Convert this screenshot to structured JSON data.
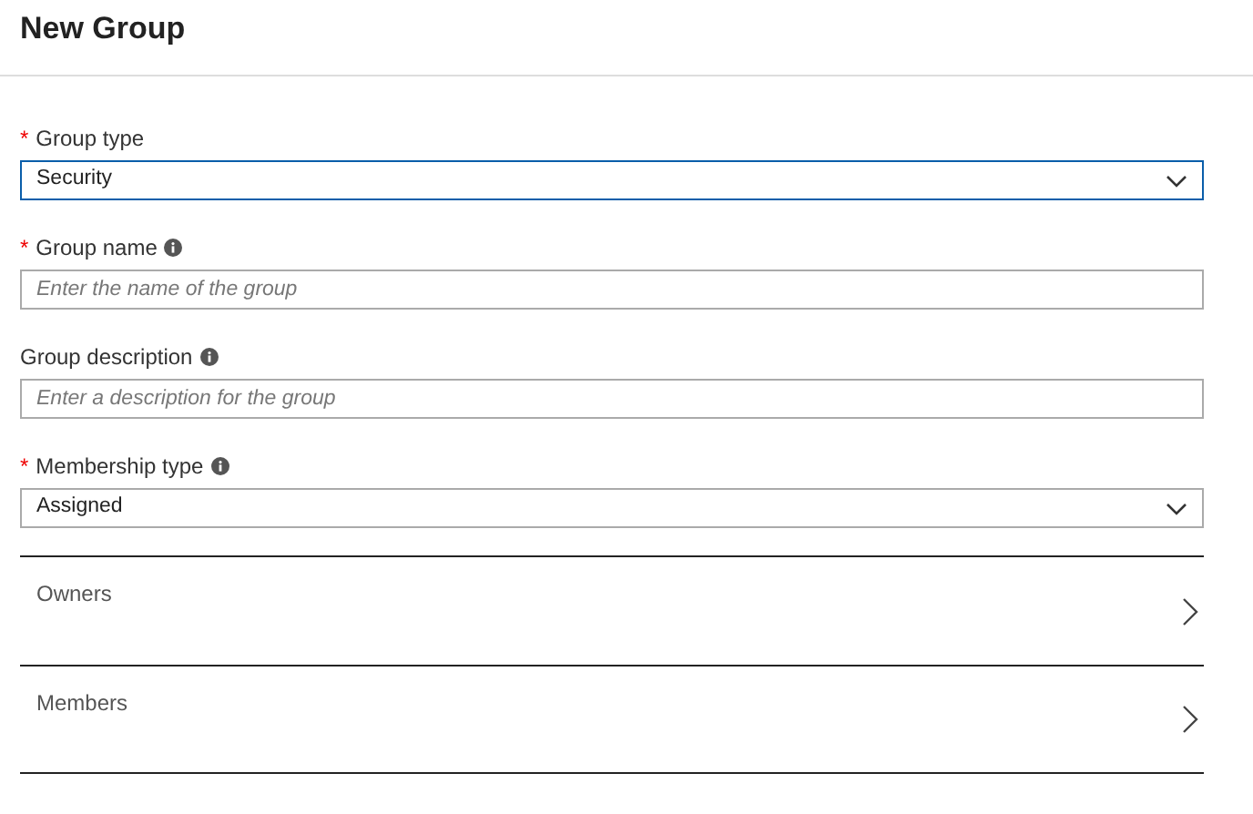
{
  "title": "New Group",
  "fields": [
    {
      "kind": "select",
      "marker": "*",
      "label": "Group type",
      "info": false,
      "value": "Security",
      "focused": true
    },
    {
      "kind": "input",
      "marker": "*",
      "label": "Group name",
      "info": true,
      "placeholder": "Enter the name of the group",
      "focused": false
    },
    {
      "kind": "input",
      "label": "Group description",
      "info": true,
      "placeholder": "Enter a description for the group",
      "focused": false
    },
    {
      "kind": "select",
      "marker": "*",
      "label": "Membership type",
      "info": true,
      "value": "Assigned",
      "focused": false
    }
  ],
  "links": [
    {
      "label": "Owners"
    },
    {
      "label": "Members"
    }
  ]
}
